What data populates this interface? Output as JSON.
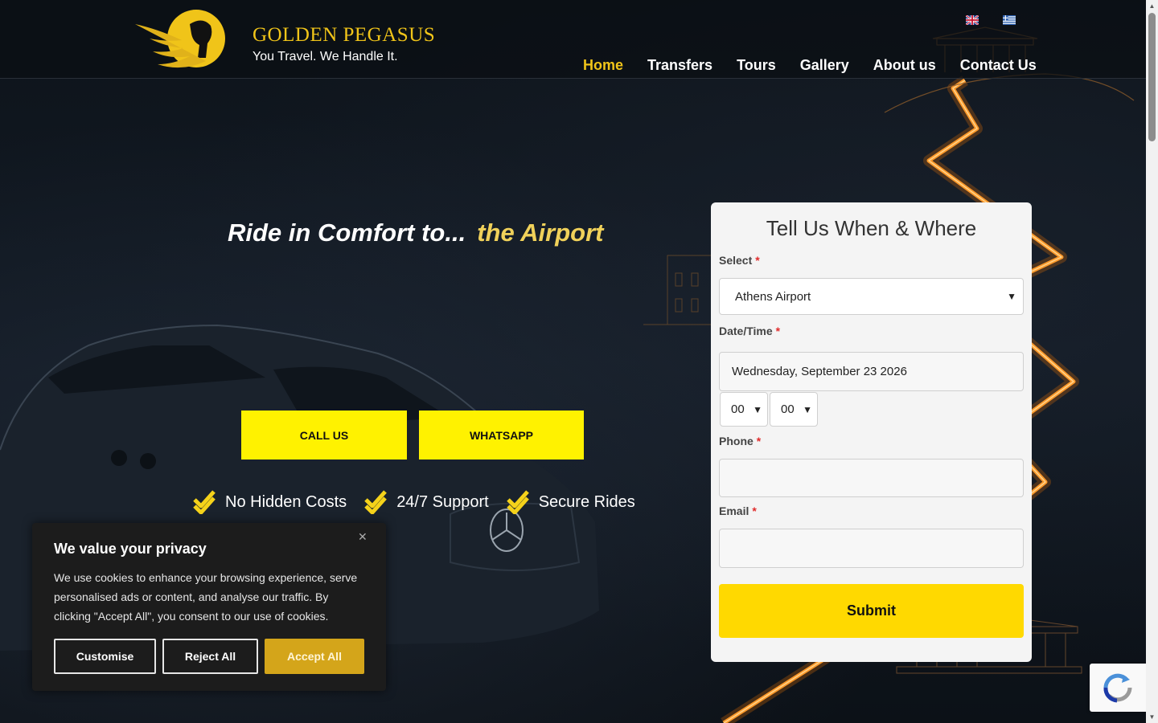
{
  "header": {
    "brand_name": "GOLDEN PEGASUS",
    "brand_tagline": "You Travel. We Handle It.",
    "nav": [
      {
        "label": "Home",
        "active": true
      },
      {
        "label": "Transfers",
        "active": false
      },
      {
        "label": "Tours",
        "active": false
      },
      {
        "label": "Gallery",
        "active": false
      },
      {
        "label": "About us",
        "active": false
      },
      {
        "label": "Contact Us",
        "active": false
      }
    ],
    "flags": [
      "uk-flag-icon",
      "greece-flag-icon"
    ]
  },
  "hero": {
    "title_prefix": "Ride in Comfort to...",
    "title_highlight": "the Airport",
    "buttons": {
      "call": "CALL US",
      "whatsapp": "WHATSAPP"
    },
    "features": [
      "No Hidden Costs",
      "24/7 Support",
      "Secure Rides"
    ]
  },
  "form": {
    "title": "Tell Us When & Where",
    "select_label": "Select",
    "select_value": "Athens Airport",
    "datetime_label": "Date/Time",
    "date_value": "Wednesday, September 23 2026",
    "hour_value": "00",
    "minute_value": "00",
    "phone_label": "Phone",
    "phone_value": "",
    "email_label": "Email",
    "email_value": "",
    "required_mark": "*",
    "submit_label": "Submit"
  },
  "cookie": {
    "title": "We value your privacy",
    "text": "We use cookies to enhance your browsing experience, serve personalised ads or content, and analyse our traffic. By clicking \"Accept All\", you consent to our use of cookies.",
    "customise": "Customise",
    "reject": "Reject All",
    "accept": "Accept All",
    "close_icon": "close-icon"
  },
  "colors": {
    "accent_gold": "#f0c419",
    "cta_yellow": "#fff200",
    "submit_yellow": "#ffd900",
    "accept_gold": "#d4a51a",
    "road_orange": "#ff8a1a"
  }
}
